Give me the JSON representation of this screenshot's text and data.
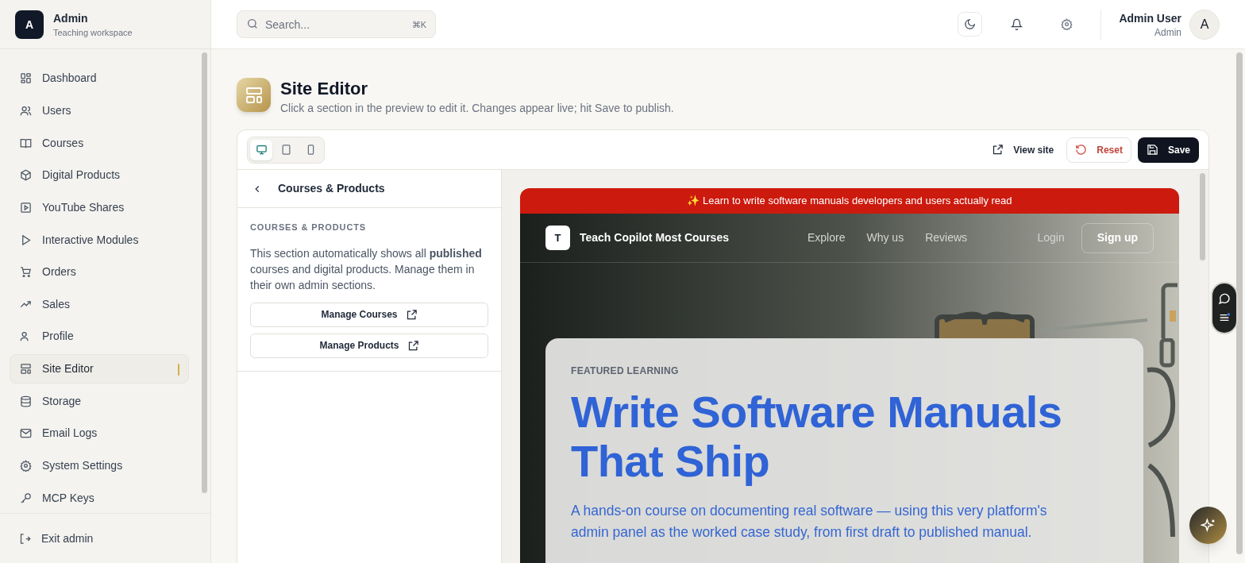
{
  "brand": {
    "logo_letter": "A",
    "name": "Admin",
    "subtitle": "Teaching workspace"
  },
  "sidebar": {
    "items": [
      {
        "label": "Dashboard",
        "selected": false
      },
      {
        "label": "Users",
        "selected": false
      },
      {
        "label": "Courses",
        "selected": false
      },
      {
        "label": "Digital Products",
        "selected": false
      },
      {
        "label": "YouTube Shares",
        "selected": false
      },
      {
        "label": "Interactive Modules",
        "selected": false
      },
      {
        "label": "Orders",
        "selected": false
      },
      {
        "label": "Sales",
        "selected": false
      },
      {
        "label": "Profile",
        "selected": false
      },
      {
        "label": "Site Editor",
        "selected": true
      },
      {
        "label": "Storage",
        "selected": false
      },
      {
        "label": "Email Logs",
        "selected": false
      },
      {
        "label": "System Settings",
        "selected": false
      },
      {
        "label": "MCP Keys",
        "selected": false
      }
    ],
    "footer_item": "Exit admin"
  },
  "search": {
    "placeholder": "Search...",
    "shortcut": "⌘K"
  },
  "header": {
    "user_name": "Admin User",
    "user_role": "Admin",
    "avatar_letter": "A"
  },
  "page": {
    "title": "Site Editor",
    "subtitle": "Click a section in the preview to edit it. Changes appear live; hit Save to publish."
  },
  "editor": {
    "devices": [
      {
        "kind": "desktop",
        "selected": true
      },
      {
        "kind": "tablet",
        "selected": false
      },
      {
        "kind": "mobile",
        "selected": false
      }
    ],
    "actions": [
      {
        "kind": "view",
        "label": "View site"
      },
      {
        "kind": "reset",
        "label": "Reset"
      },
      {
        "kind": "save",
        "label": "Save"
      }
    ],
    "panel": {
      "title": "Courses & Products",
      "section_heading": "COURSES & PRODUCTS",
      "description": "This section automatically shows all **published** courses and digital products. Manage them in their own admin sections.",
      "buttons": [
        "Manage Courses",
        "Manage Products"
      ]
    },
    "preview": {
      "banner": "✨ Learn to write software manuals developers and users actually read",
      "site_logo_letter": "T",
      "site_name": "Teach Copilot Most Courses",
      "nav_links": [
        "Explore",
        "Why us",
        "Reviews"
      ],
      "login": "Login",
      "signup": "Sign up",
      "hero": {
        "eyebrow": "FEATURED LEARNING",
        "title": "Write Software Manuals That Ship",
        "description": "A hands-on course on documenting real software — using this very platform's admin panel as the worked case study, from first draft to published manual."
      }
    }
  }
}
